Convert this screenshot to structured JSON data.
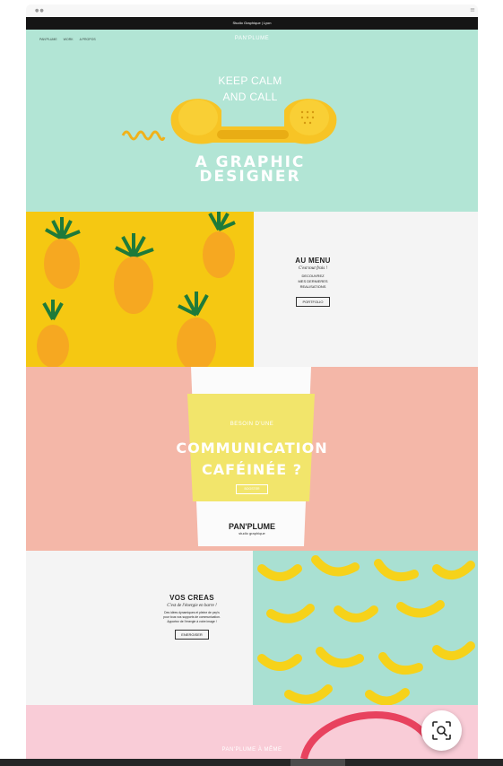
{
  "browser": {
    "dots": "●●",
    "menu_icon": "≡"
  },
  "topbar": {
    "text": "Studio Graphique  |  Lyon"
  },
  "nav": {
    "items": [
      "PAN'PLUME",
      "WORK",
      "A PROPOS"
    ]
  },
  "hero": {
    "brand": "PAN'PLUME",
    "line1": "KEEP CALM",
    "line2": "AND CALL",
    "headline1": "A GRAPHIC",
    "headline2": "DESIGNER",
    "icon": "telephone-handset-icon"
  },
  "menu_tile": {
    "title": "AU MENU",
    "script": "C'est tout frais !",
    "lines": [
      "DECOUVREZ",
      "MES DERNIERES",
      "REALISATIONS"
    ],
    "button": "PORTFOLIO"
  },
  "coffee": {
    "eyebrow": "BESOIN D'UNE",
    "line1": "COMMUNICATION",
    "line2": "CAFÉINÉE ?",
    "button": "BOOSTER",
    "cup_brand": "PAN'PLUME",
    "cup_sub": "studio graphique"
  },
  "creas_tile": {
    "title": "VOS CREAS",
    "script": "C'est de l'énergie en barre !",
    "lines": [
      "Des idées dynamiques et pleine de pep's",
      "pour tous vos supports de communication.",
      "Apportez de l'énergie à votre image !"
    ],
    "button": "ENERGISER"
  },
  "footer_section": {
    "text": "PAN'PLUME À MÊME"
  },
  "colors": {
    "mint": "#b2e5d5",
    "yellow": "#f5c812",
    "salmon": "#f4b7a8",
    "banana_mint": "#a9e0d2",
    "pink": "#f9ccd7"
  }
}
